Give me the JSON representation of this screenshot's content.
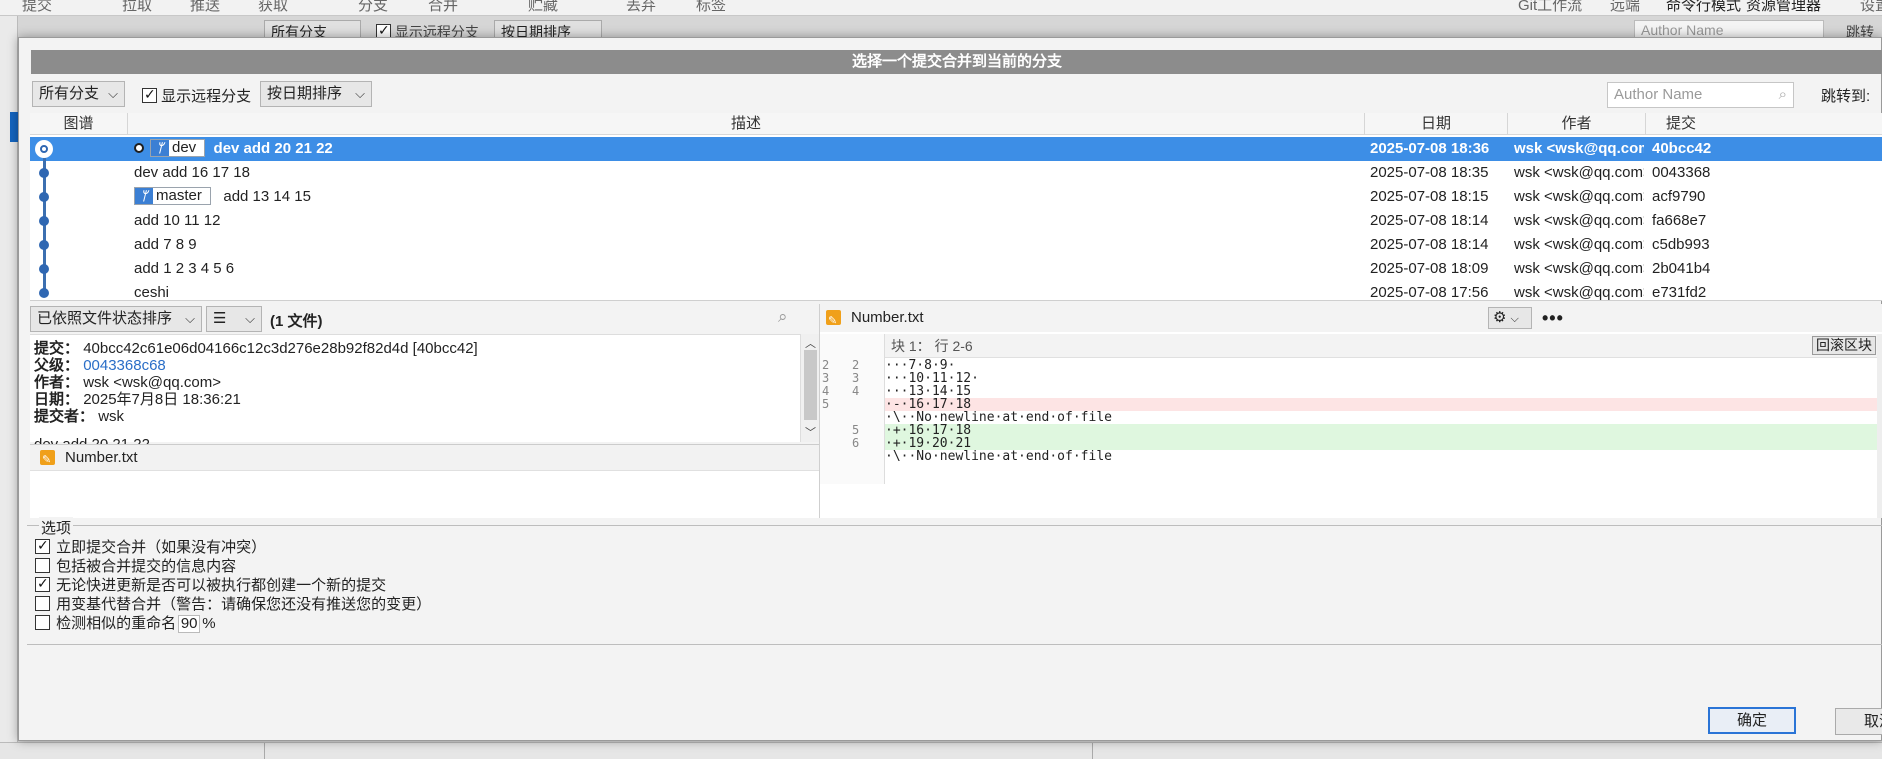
{
  "background": {
    "toolbar_items": [
      "提交",
      "拉取",
      "推送",
      "获取",
      "分支",
      "合并",
      "贮藏",
      "丢弃",
      "标签",
      "Git工作流",
      "远端",
      "命令行模式",
      "资源管理器",
      "设置"
    ],
    "filters": {
      "branches": "所有分支",
      "show_remote": "显示远程分支",
      "sort": "按日期排序",
      "search_placeholder": "Author Name",
      "jump": "跳转"
    }
  },
  "dialog": {
    "title": "选择一个提交合并到当前的分支",
    "branch_filter": "所有分支",
    "show_remote_label": "显示远程分支",
    "show_remote_checked": true,
    "sort_label": "按日期排序",
    "search_placeholder": "Author Name",
    "jump_label": "跳转到:"
  },
  "table": {
    "columns": {
      "graph": "图谱",
      "desc": "描述",
      "date": "日期",
      "author": "作者",
      "commit": "提交"
    },
    "rows": [
      {
        "branch": "dev",
        "desc": "dev add 20 21 22",
        "date": "2025-07-08 18:36",
        "author": "wsk <wsk@qq.com>",
        "commit": "40bcc42",
        "selected": true
      },
      {
        "branch": "",
        "desc": "dev add 16 17 18",
        "date": "2025-07-08 18:35",
        "author": "wsk <wsk@qq.com>",
        "commit": "0043368"
      },
      {
        "branch": "master",
        "desc": "add 13 14 15",
        "date": "2025-07-08 18:15",
        "author": "wsk <wsk@qq.com>",
        "commit": "acf9790"
      },
      {
        "branch": "",
        "desc": "add 10 11 12",
        "date": "2025-07-08 18:14",
        "author": "wsk <wsk@qq.com>",
        "commit": "fa668e7"
      },
      {
        "branch": "",
        "desc": "add 7 8 9",
        "date": "2025-07-08 18:14",
        "author": "wsk <wsk@qq.com>",
        "commit": "c5db993"
      },
      {
        "branch": "",
        "desc": "add 1 2 3 4 5 6",
        "date": "2025-07-08 18:09",
        "author": "wsk <wsk@qq.com>",
        "commit": "2b041b4"
      },
      {
        "branch": "",
        "desc": "ceshi",
        "date": "2025-07-08 17:56",
        "author": "wsk <wsk@qq.com>",
        "commit": "e731fd2"
      }
    ]
  },
  "files_bar": {
    "sort_label": "已依照文件状态排序",
    "view_icon": "list-icon",
    "count": "(1 文件)"
  },
  "details": {
    "commit_label": "提交：",
    "commit_value": "40bcc42c61e06d04166c12c3d276e28b92f82d4d [40bcc42]",
    "parent_label": "父级：",
    "parent_value": "0043368c68",
    "author_label": "作者：",
    "author_value": "wsk <wsk@qq.com>",
    "date_label": "日期：",
    "date_value": "2025年7月8日 18:36:21",
    "committer_label": "提交者：",
    "committer_value": "wsk",
    "message": "dev add 20 21 22"
  },
  "file_list": [
    {
      "name": "Number.txt",
      "status_color": "#f0a01a"
    }
  ],
  "diff": {
    "file": "Number.txt",
    "hunk_label": "块 1： 行 2-6",
    "revert_label": "回滚区块",
    "lines": [
      {
        "old": "2",
        "new": "2",
        "type": "ctx",
        "text": "···7·8·9·"
      },
      {
        "old": "3",
        "new": "3",
        "type": "ctx",
        "text": "···10·11·12·"
      },
      {
        "old": "4",
        "new": "4",
        "type": "ctx",
        "text": "···13·14·15"
      },
      {
        "old": "5",
        "new": "",
        "type": "rm",
        "text": "·-·16·17·18"
      },
      {
        "old": "",
        "new": "",
        "type": "ctx",
        "text": "·\\··No·newline·at·end·of·file"
      },
      {
        "old": "",
        "new": "5",
        "type": "ad",
        "text": "·+·16·17·18"
      },
      {
        "old": "",
        "new": "6",
        "type": "ad",
        "text": "·+·19·20·21"
      },
      {
        "old": "",
        "new": "",
        "type": "ctx",
        "text": "·\\··No·newline·at·end·of·file"
      }
    ]
  },
  "options": {
    "group_label": "选项",
    "items": [
      {
        "label": "立即提交合并（如果没有冲突）",
        "checked": true
      },
      {
        "label": "包括被合并提交的信息内容",
        "checked": false
      },
      {
        "label": "无论快进更新是否可以被执行都创建一个新的提交",
        "checked": true
      },
      {
        "label": "用变基代替合并（警告：请确保您还没有推送您的变更）",
        "checked": false
      },
      {
        "label": "检测相似的重命名",
        "checked": false
      }
    ],
    "similarity_value": "90",
    "similarity_unit": "%"
  },
  "buttons": {
    "ok": "确定",
    "cancel": "取消"
  },
  "colors": {
    "selection": "#3d8ee6",
    "graph": "#2f67b2",
    "removed_bg": "#fde4e4",
    "added_bg": "#dff7df",
    "accent": "#2a74d6"
  }
}
